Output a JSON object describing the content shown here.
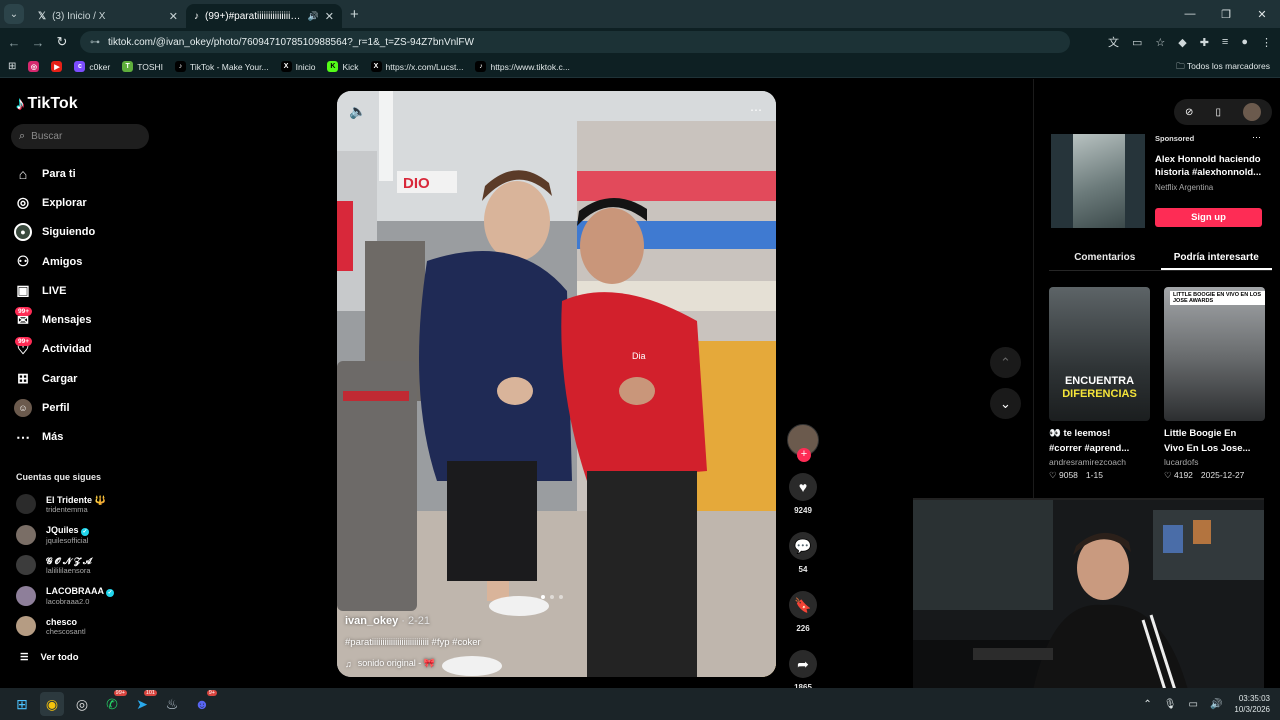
{
  "browser": {
    "tabs": [
      {
        "title": "(3) Inicio / X",
        "active": false
      },
      {
        "title": "(99+)#paratiiiiiiiiiiiiiiiiiiiiii",
        "active": true
      }
    ],
    "url": "tiktok.com/@ivan_okey/photo/7609471078510988564?_r=1&_t=ZS-94Z7bnVnlFW",
    "bookmarks": [
      "",
      "",
      "c0ker",
      "TOSHI",
      "TikTok - Make Your...",
      "Inicio",
      "Kick",
      "https://x.com/Lucst...",
      "https://www.tiktok.c..."
    ],
    "all_bookmarks": "Todos los marcadores"
  },
  "sidebar": {
    "brand": "TikTok",
    "search_placeholder": "Buscar",
    "nav": [
      {
        "label": "Para ti",
        "icon": "home-icon",
        "badge": ""
      },
      {
        "label": "Explorar",
        "icon": "compass-icon",
        "badge": ""
      },
      {
        "label": "Siguiendo",
        "icon": "following-icon",
        "badge": ""
      },
      {
        "label": "Amigos",
        "icon": "friends-icon",
        "badge": ""
      },
      {
        "label": "LIVE",
        "icon": "live-icon",
        "badge": ""
      },
      {
        "label": "Mensajes",
        "icon": "messages-icon",
        "badge": "99+"
      },
      {
        "label": "Actividad",
        "icon": "activity-icon",
        "badge": "99+"
      },
      {
        "label": "Cargar",
        "icon": "upload-icon",
        "badge": ""
      },
      {
        "label": "Perfil",
        "icon": "profile-icon",
        "badge": ""
      },
      {
        "label": "Más",
        "icon": "more-icon",
        "badge": ""
      }
    ],
    "following_title": "Cuentas que sigues",
    "following": [
      {
        "name": "El Tridente 🔱",
        "handle": "tridentemma",
        "verified": false
      },
      {
        "name": "JQuiles",
        "handle": "jquilesofficial",
        "verified": true
      },
      {
        "name": "𝓖 𝓞 𝓝 𝓩 𝓐",
        "handle": "lalilililaensora",
        "verified": false
      },
      {
        "name": "LACOBRAAA",
        "handle": "lacobraaa2.0",
        "verified": true
      },
      {
        "name": "chesco",
        "handle": "chescosantl",
        "verified": false
      }
    ],
    "see_all": "Ver todo"
  },
  "video": {
    "username": "ivan_okey",
    "date": " · 2-21",
    "caption": "#paratiiiiiiiiiiiiiiiiiiiiiiiiiii #fyp #coker",
    "sound": "sonido original - 🎀",
    "shirt_logo": "Dia",
    "store_sign": "DIO",
    "likes": "9249",
    "comments": "54",
    "saves": "226",
    "shares": "1865"
  },
  "right": {
    "ad": {
      "sponsored": "Sponsored",
      "title_line1": "Alex Honnold haciendo",
      "title_line2": "historia #alexhonnold...",
      "advertiser": "Netflix Argentina",
      "cta": "Sign up"
    },
    "tabs": [
      "Comentarios",
      "Podría interesarte"
    ],
    "cards": [
      {
        "overlay1": "ENCUENTRA",
        "overlay2": "DIFERENCIAS",
        "title1": "👀 te leemos!",
        "title2": "#correr #aprend...",
        "author": "andresramirezcoach",
        "likes": "9058",
        "date": "1-15",
        "tag": ""
      },
      {
        "overlay1": "",
        "overlay2": "",
        "title1": "Little Boogie En",
        "title2": "Vivo En Los Jose...",
        "author": "lucardofs",
        "likes": "4192",
        "date": "2025-12-27",
        "tag": "LITTLE BOOGIE EN VIVO EN LOS JOSE AWARDS"
      }
    ]
  },
  "taskbar": {
    "time": "03:35:03",
    "date": "10/3/2026",
    "badge_whatsapp": "99+",
    "badge_telegram": "101",
    "badge_discord": "9+"
  },
  "colors": {
    "accent": "#fe2c55",
    "verified": "#20d5ec",
    "chrome_bg": "#0e2023"
  }
}
